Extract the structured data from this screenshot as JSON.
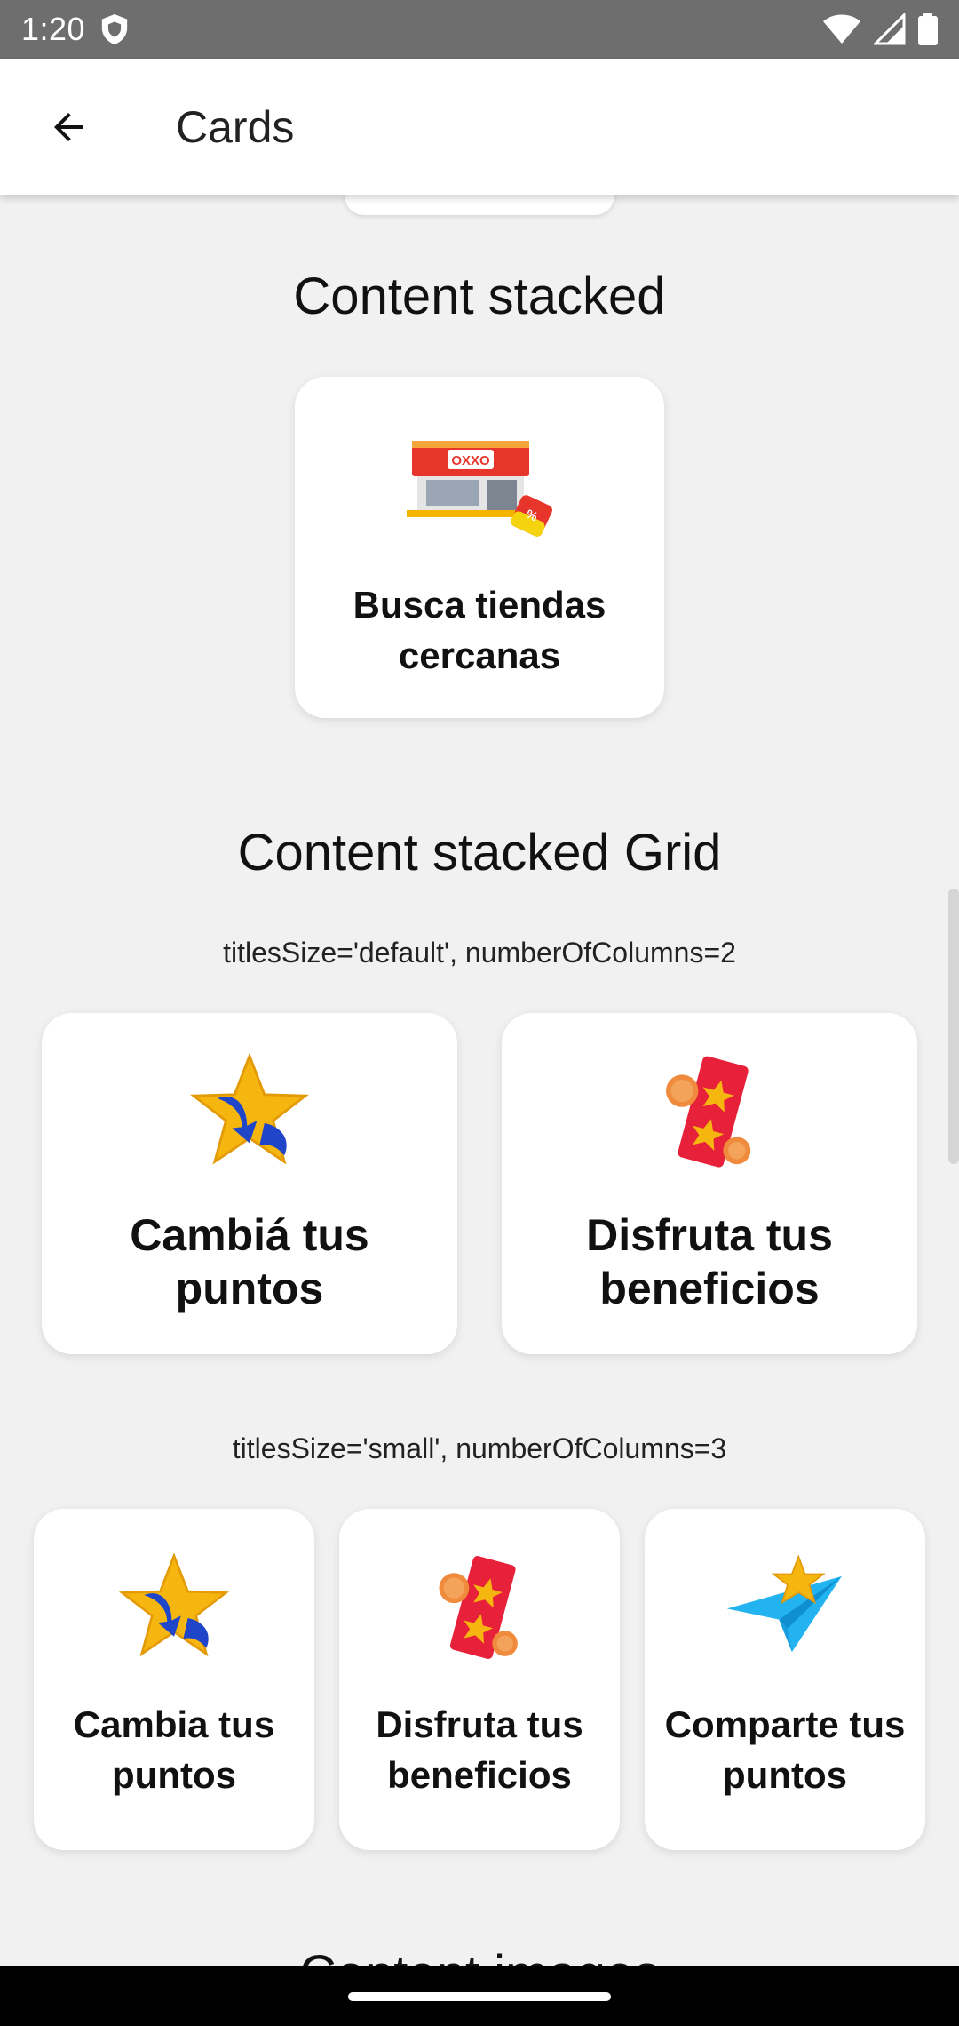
{
  "status_bar": {
    "time": "1:20"
  },
  "app_bar": {
    "title": "Cards"
  },
  "sections": {
    "content_stacked": {
      "title": "Content stacked",
      "card_label": "Busca tiendas cercanas"
    },
    "content_stacked_grid": {
      "title": "Content stacked Grid",
      "grid_two": {
        "caption": "titlesSize='default', numberOfColumns=2",
        "cards": [
          {
            "label": "Cambiá tus puntos",
            "icon": "star-swap-icon"
          },
          {
            "label": "Disfruta tus beneficios",
            "icon": "ticket-coins-icon"
          }
        ]
      },
      "grid_three": {
        "caption": "titlesSize='small', numberOfColumns=3",
        "cards": [
          {
            "label": "Cambia tus puntos",
            "icon": "star-swap-icon"
          },
          {
            "label": "Disfruta tus beneficios",
            "icon": "ticket-coins-icon"
          },
          {
            "label": "Comparte tus puntos",
            "icon": "paper-plane-star-icon"
          }
        ]
      }
    },
    "next_section_title": "Content images"
  },
  "colors": {
    "store_red": "#e8352b",
    "star_gold": "#f5b70f",
    "arrow_blue": "#1f46c8",
    "ticket_red": "#e8213a",
    "plane_cyan": "#22b3f0"
  }
}
